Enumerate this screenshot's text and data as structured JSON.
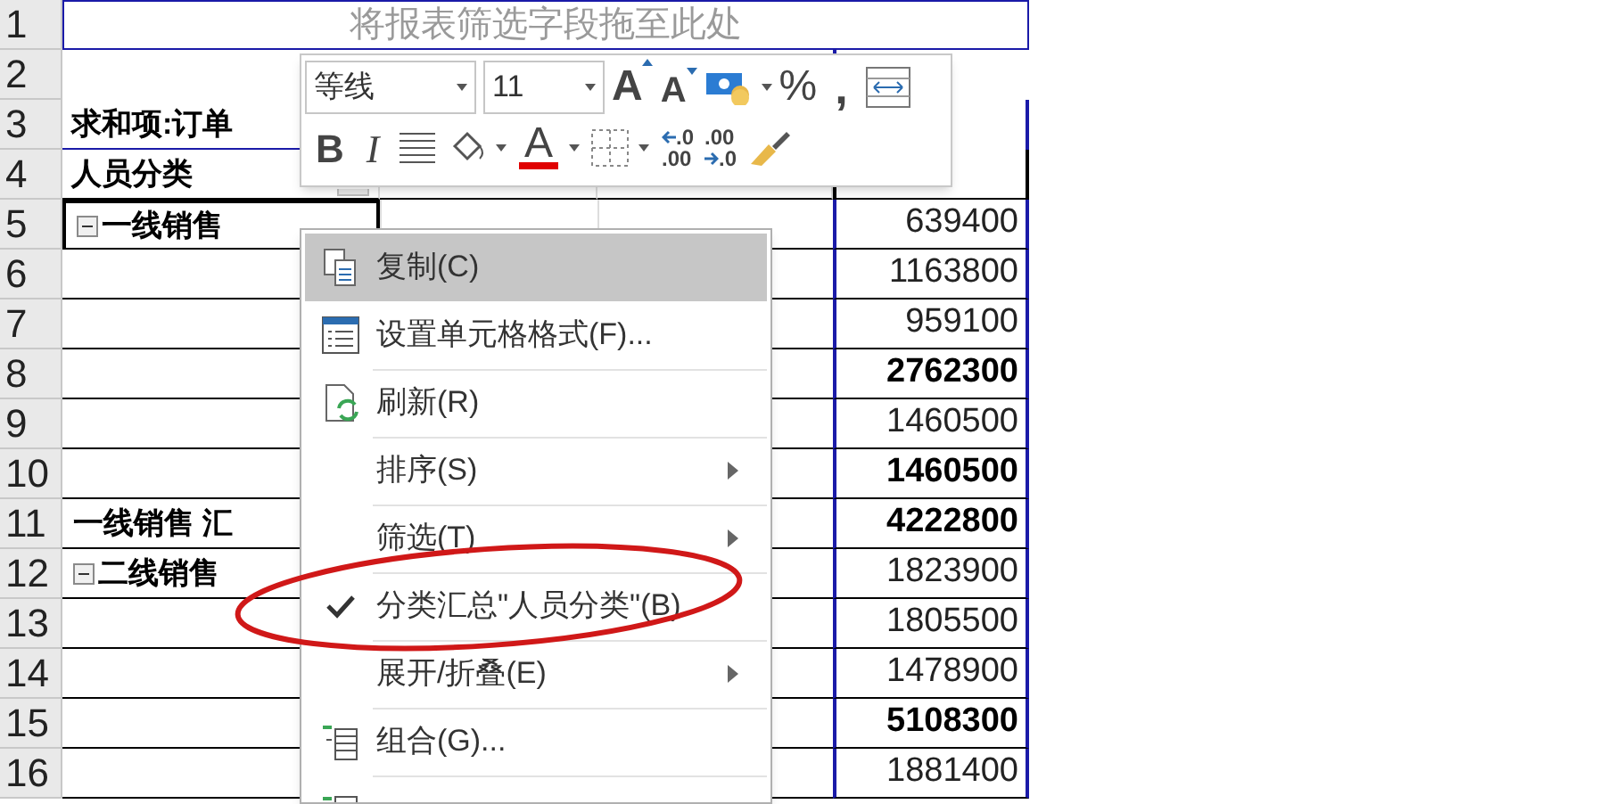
{
  "pivot_filter_hint": "将报表筛选字段拖至此处",
  "row_numbers": [
    "1",
    "2",
    "3",
    "4",
    "5",
    "6",
    "7",
    "8",
    "9",
    "10",
    "11",
    "12",
    "13",
    "14",
    "15",
    "16"
  ],
  "value_label": "求和项:订单",
  "headers": [
    {
      "text": "人员分类",
      "filter": true
    }
  ],
  "rows": [
    {
      "group": "一线销售",
      "group_collapsible": true,
      "total": "639400",
      "bold": false,
      "selected": true
    },
    {
      "total": "1163800",
      "bold": false,
      "selected": false
    },
    {
      "total": "959100",
      "bold": false,
      "selected": false
    },
    {
      "total": "2762300",
      "bold": true,
      "selected": false
    },
    {
      "total": "1460500",
      "bold": false,
      "selected": false
    },
    {
      "total": "1460500",
      "bold": true,
      "selected": false
    },
    {
      "group": "一线销售 汇",
      "group_collapsible": false,
      "total": "4222800",
      "bold": true,
      "selected": false
    },
    {
      "group": "二线销售",
      "group_collapsible": true,
      "total": "1823900",
      "bold": false,
      "selected": false
    },
    {
      "total": "1805500",
      "bold": false,
      "selected": false
    },
    {
      "total": "1478900",
      "bold": false,
      "selected": false
    },
    {
      "total": "5108300",
      "bold": true,
      "selected": false
    },
    {
      "total": "1881400",
      "bold": false,
      "selected": false
    }
  ],
  "mini_toolbar": {
    "font": "等线",
    "size": "11",
    "percent": "%",
    "comma": ",",
    "bold": "B",
    "italic": "I",
    "font_color_letter": "A",
    "grow_letter": "A",
    "shrink_letter": "A",
    "increase_decimal": [
      ".0",
      ".00"
    ],
    "decrease_decimal": [
      ".00",
      ".0"
    ]
  },
  "context_menu": [
    {
      "label": "复制(C)",
      "highlighted": true,
      "checked": false,
      "submenu": false
    },
    {
      "label": "设置单元格格式(F)...",
      "highlighted": false,
      "checked": false,
      "submenu": false
    },
    {
      "label": "刷新(R)",
      "highlighted": false,
      "checked": false,
      "submenu": false
    },
    {
      "label": "排序(S)",
      "highlighted": false,
      "checked": false,
      "submenu": true
    },
    {
      "label": "筛选(T)",
      "highlighted": false,
      "checked": false,
      "submenu": true
    },
    {
      "label": "分类汇总\"人员分类\"(B)",
      "highlighted": false,
      "checked": true,
      "submenu": false
    },
    {
      "label": "展开/折叠(E)",
      "highlighted": false,
      "checked": false,
      "submenu": true
    },
    {
      "label": "组合(G)...",
      "highlighted": false,
      "checked": false,
      "submenu": false
    },
    {
      "highlighted": false,
      "checked": false,
      "submenu": false
    }
  ]
}
